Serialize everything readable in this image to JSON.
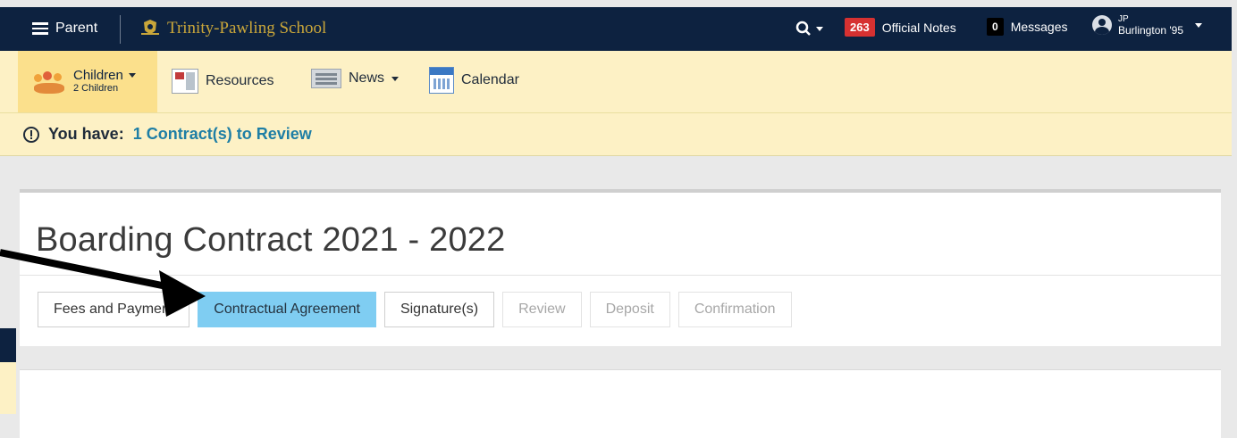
{
  "topbar": {
    "menu_label": "Parent",
    "brand_name": "Trinity-Pawling School",
    "official_notes_count": "263",
    "official_notes_label": "Official Notes",
    "messages_count": "0",
    "messages_label": "Messages",
    "user_initials": "JP",
    "user_class": "Burlington '95"
  },
  "subnav": {
    "children_label": "Children",
    "children_count": "2 Children",
    "resources_label": "Resources",
    "news_label": "News",
    "calendar_label": "Calendar"
  },
  "alert": {
    "prefix": "You have:",
    "link_text": "1 Contract(s) to Review"
  },
  "page": {
    "title": "Boarding Contract 2021 - 2022",
    "steps": [
      {
        "label": "Fees and Payment",
        "state": "normal"
      },
      {
        "label": "Contractual Agreement",
        "state": "active"
      },
      {
        "label": "Signature(s)",
        "state": "normal"
      },
      {
        "label": "Review",
        "state": "disabled"
      },
      {
        "label": "Deposit",
        "state": "disabled"
      },
      {
        "label": "Confirmation",
        "state": "disabled"
      }
    ]
  },
  "colors": {
    "navy": "#0d2240",
    "gold": "#c9a63a",
    "active_step": "#7fcdf2",
    "badge_red": "#d63131",
    "link_blue": "#1e7ea5"
  },
  "icons": [
    "hamburger-icon",
    "crest-icon",
    "search-icon",
    "caret-down-icon",
    "avatar-icon",
    "children-icon",
    "resources-icon",
    "news-icon",
    "calendar-icon",
    "alert-icon",
    "arrow-annotation"
  ]
}
